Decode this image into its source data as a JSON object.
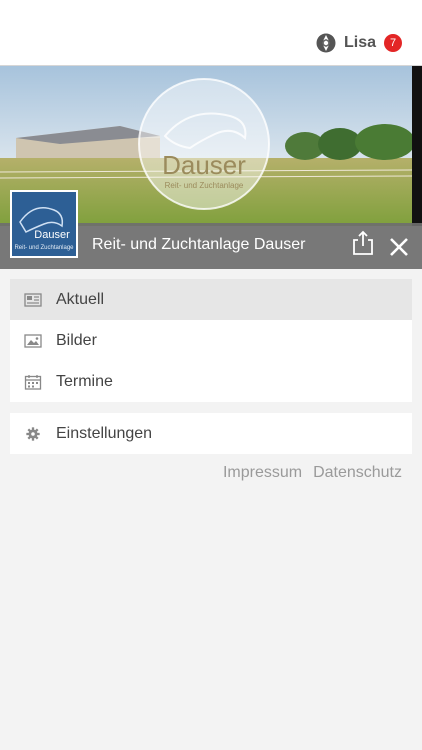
{
  "header": {
    "user_name": "Lisa",
    "notification_count": "7"
  },
  "hero": {
    "logo_title": "Dauser",
    "logo_subtitle": "Reit- und Zuchtanlage"
  },
  "club": {
    "name": "Reit- und Zuchtanlage Dauser",
    "thumb_title": "Dauser",
    "thumb_subtitle": "Reit- und Zuchtanlage"
  },
  "menu": {
    "items": [
      {
        "label": "Aktuell",
        "icon": "newspaper-icon",
        "active": true
      },
      {
        "label": "Bilder",
        "icon": "image-icon",
        "active": false
      },
      {
        "label": "Termine",
        "icon": "calendar-icon",
        "active": false
      }
    ],
    "settings": {
      "label": "Einstellungen",
      "icon": "gear-icon"
    }
  },
  "footer": {
    "impressum": "Impressum",
    "datenschutz": "Datenschutz"
  },
  "colors": {
    "badge": "#e32626",
    "titlebar": "#6e6e6e",
    "active_item": "#e6e6e6",
    "thumb_bg": "#2d5f95"
  }
}
